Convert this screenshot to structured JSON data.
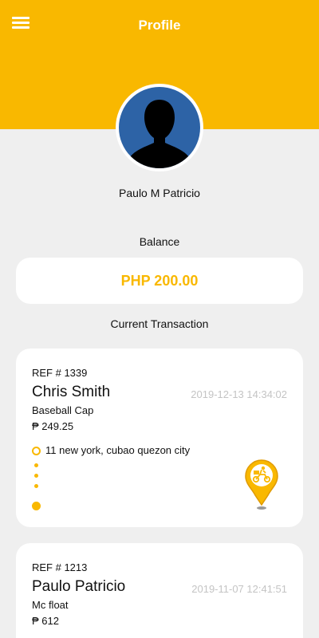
{
  "header": {
    "title": "Profile",
    "menu_icon": "hamburger-menu-icon"
  },
  "profile": {
    "avatar_icon": "person-silhouette-icon",
    "name": "Paulo M Patricio"
  },
  "balance": {
    "label": "Balance",
    "amount": "PHP 200.00"
  },
  "current_transaction_label": "Current Transaction",
  "transactions": [
    {
      "ref": "REF # 1339",
      "name": "Chris Smith",
      "timestamp": "2019-12-13 14:34:02",
      "item": "Baseball Cap",
      "price": "₱ 249.25",
      "address": "11 new york, cubao quezon city",
      "pin_icon": "delivery-rider-pin-icon"
    },
    {
      "ref": "REF # 1213",
      "name": "Paulo Patricio",
      "timestamp": "2019-11-07 12:41:51",
      "item": "Mc float",
      "price": "₱ 612"
    }
  ],
  "colors": {
    "accent": "#f9b800",
    "background": "#efefef",
    "avatar_bg": "#2d63a6",
    "timestamp": "#c4c4c4"
  }
}
